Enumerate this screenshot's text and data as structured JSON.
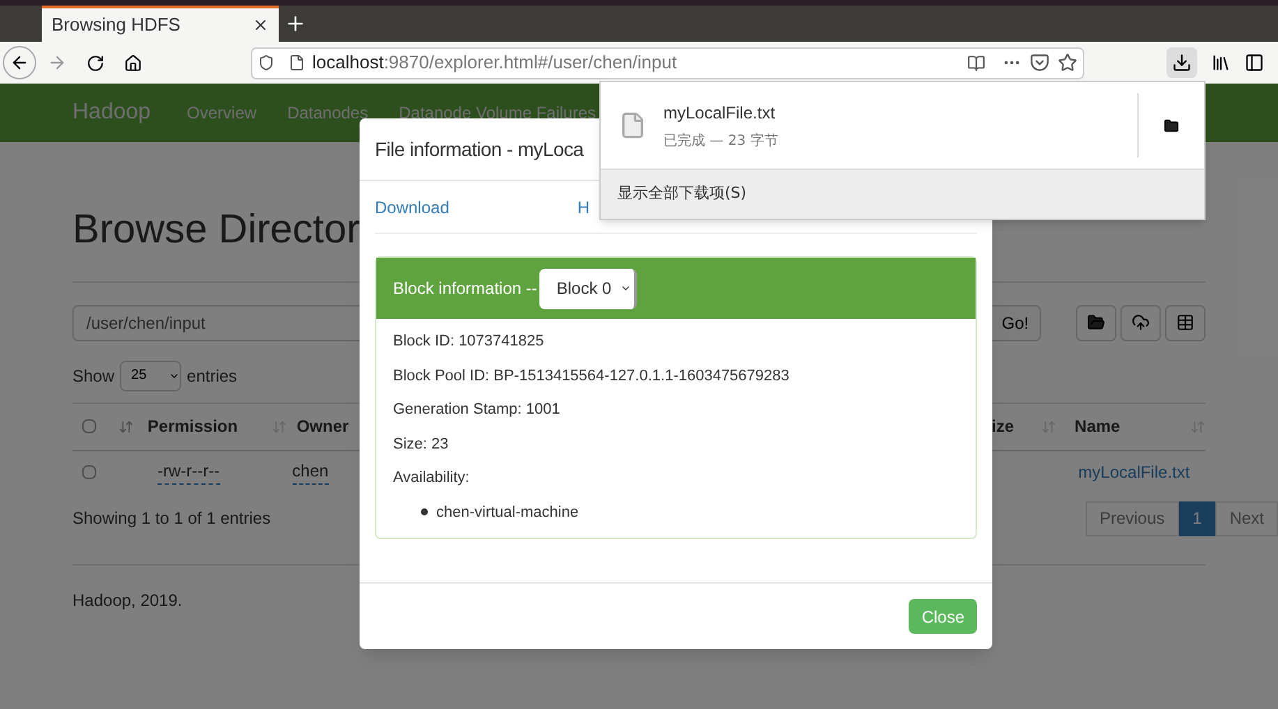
{
  "browser": {
    "tab": {
      "title": "Browsing HDFS",
      "selected": true
    },
    "url": {
      "host": "localhost",
      "path": ":9870/explorer.html#/user/chen/input"
    }
  },
  "navbar": {
    "brand": "Hadoop",
    "items": [
      "Overview",
      "Datanodes",
      "Datanode Volume Failures"
    ]
  },
  "page": {
    "heading": "Browse Director",
    "path_value": "/user/chen/input",
    "go": "Go!",
    "show_label": "Show",
    "page_size": "25",
    "entries_label": "entries",
    "select_all_checked": false,
    "columns": [
      "Permission",
      "Owner",
      "ize",
      "Name"
    ],
    "rows": [
      {
        "permission": "-rw-r--r--",
        "owner": "chen",
        "name": "myLocalFile.txt",
        "checked": false
      }
    ],
    "info": "Showing 1 to 1 of 1 entries",
    "pagination": [
      {
        "label": "Previous",
        "selected": false
      },
      {
        "label": "1",
        "selected": true
      },
      {
        "label": "Next",
        "selected": false
      }
    ],
    "footer": "Hadoop, 2019."
  },
  "modal": {
    "title": "File information - myLoca",
    "links": [
      "Download",
      "H"
    ],
    "block_title": "Block information --",
    "block_select": "Block 0",
    "fields": [
      "Block ID: 1073741825",
      "Block Pool ID: BP-1513415564-127.0.1.1-1603475679283",
      "Generation Stamp: 1001",
      "Size: 23",
      "Availability:"
    ],
    "hosts": [
      "chen-virtual-machine"
    ],
    "close": "Close"
  },
  "downloads": {
    "items": [
      {
        "name": "myLocalFile.txt",
        "status": "已完成 — 23 字节"
      }
    ],
    "show_all": "显示全部下载项(S)"
  }
}
